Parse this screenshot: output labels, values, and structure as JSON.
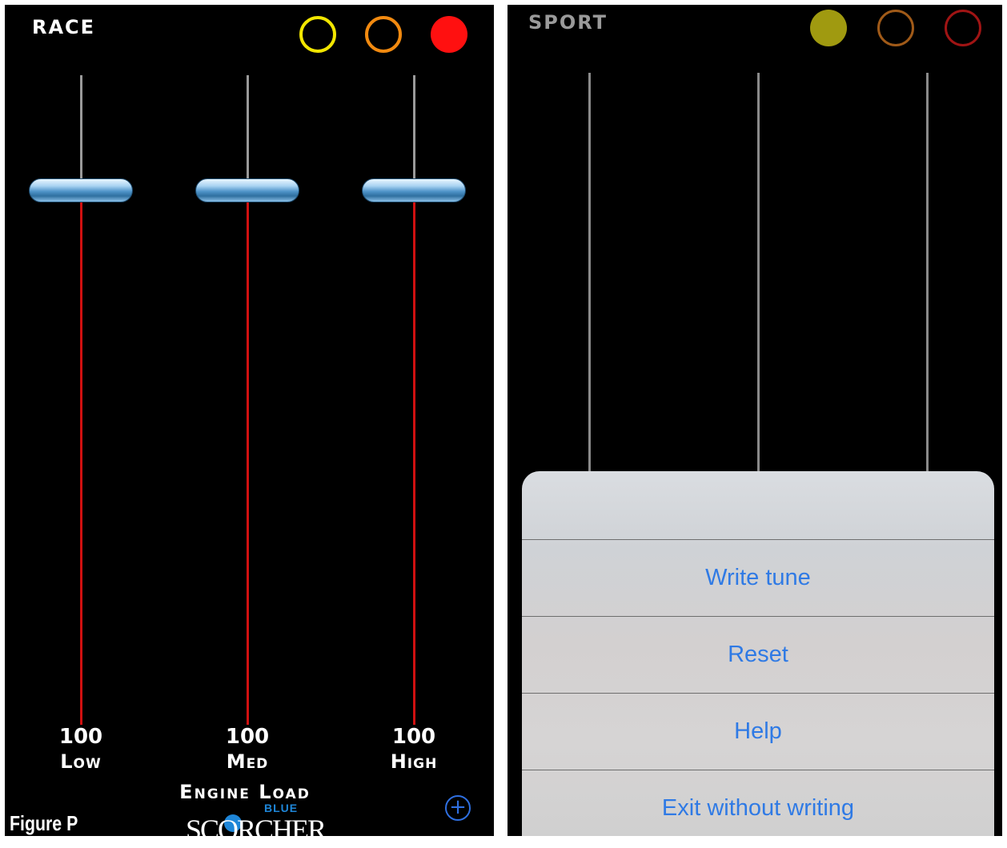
{
  "left": {
    "mode_title": "RACE",
    "circles": [
      {
        "name": "yellow",
        "color": "#f2e600",
        "filled": false
      },
      {
        "name": "orange",
        "color": "#f28a10",
        "filled": false
      },
      {
        "name": "red",
        "color": "#ff1010",
        "filled": true
      }
    ],
    "sliders": [
      {
        "value": "100",
        "label": "Low"
      },
      {
        "value": "100",
        "label": "Med"
      },
      {
        "value": "100",
        "label": "High"
      }
    ],
    "engine_load_label": "Engine Load",
    "plus_symbol": "+",
    "logo": {
      "top": "BLUE",
      "main": "SCORCHER"
    }
  },
  "figure_label": "Figure P",
  "right": {
    "mode_title": "SPORT",
    "circles": [
      {
        "name": "yellow",
        "color": "#a09a10",
        "filled": true
      },
      {
        "name": "orange",
        "color": "#a05a18",
        "filled": false
      },
      {
        "name": "red",
        "color": "#a01414",
        "filled": false
      }
    ],
    "action_sheet": {
      "items": [
        "Write tune",
        "Reset",
        "Help",
        "Exit without writing"
      ]
    }
  }
}
